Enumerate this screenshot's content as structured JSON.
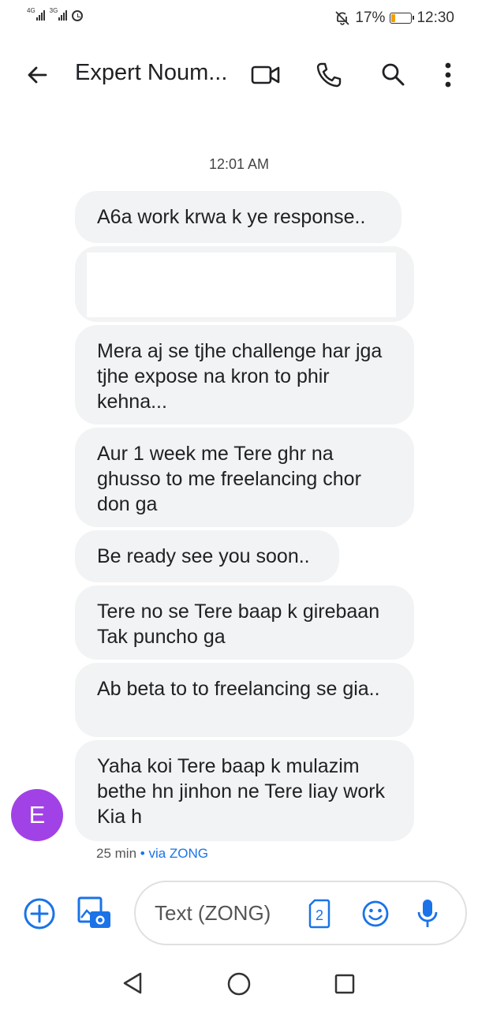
{
  "status_bar": {
    "network1": "4G",
    "network2": "3G",
    "battery_percent": "17%",
    "battery_level": 0.17,
    "time": "12:30"
  },
  "header": {
    "title": "Expert Noum...",
    "icons": [
      "back-arrow-icon",
      "video-call-icon",
      "phone-icon",
      "search-icon",
      "more-vert-icon"
    ]
  },
  "conversation": {
    "timestamp": "12:01 AM",
    "messages": [
      "A6a work krwa k ye response..",
      "",
      "Mera aj se tjhe challenge har jga tjhe expose na kron to phir kehna...",
      "Aur 1 week me Tere ghr na ghusso to me freelancing chor don ga",
      "Be ready see you soon..",
      "Tere no se Tere baap k girebaan Tak puncho ga",
      "Ab beta to to freelancing se gia..",
      "Yaha koi Tere baap k mulazim bethe hn jinhon ne Tere liay work Kia h"
    ],
    "avatar_letter": "E",
    "avatar_color": "#a142e6",
    "meta_time": "25 min",
    "meta_separator": "•",
    "meta_via": "via ZONG"
  },
  "composer": {
    "placeholder": "Text (ZONG)",
    "sim_badge": "2",
    "accent_color": "#1a73e8"
  },
  "nav_bar": {
    "icons": [
      "nav-back-icon",
      "nav-home-icon",
      "nav-recents-icon"
    ]
  }
}
